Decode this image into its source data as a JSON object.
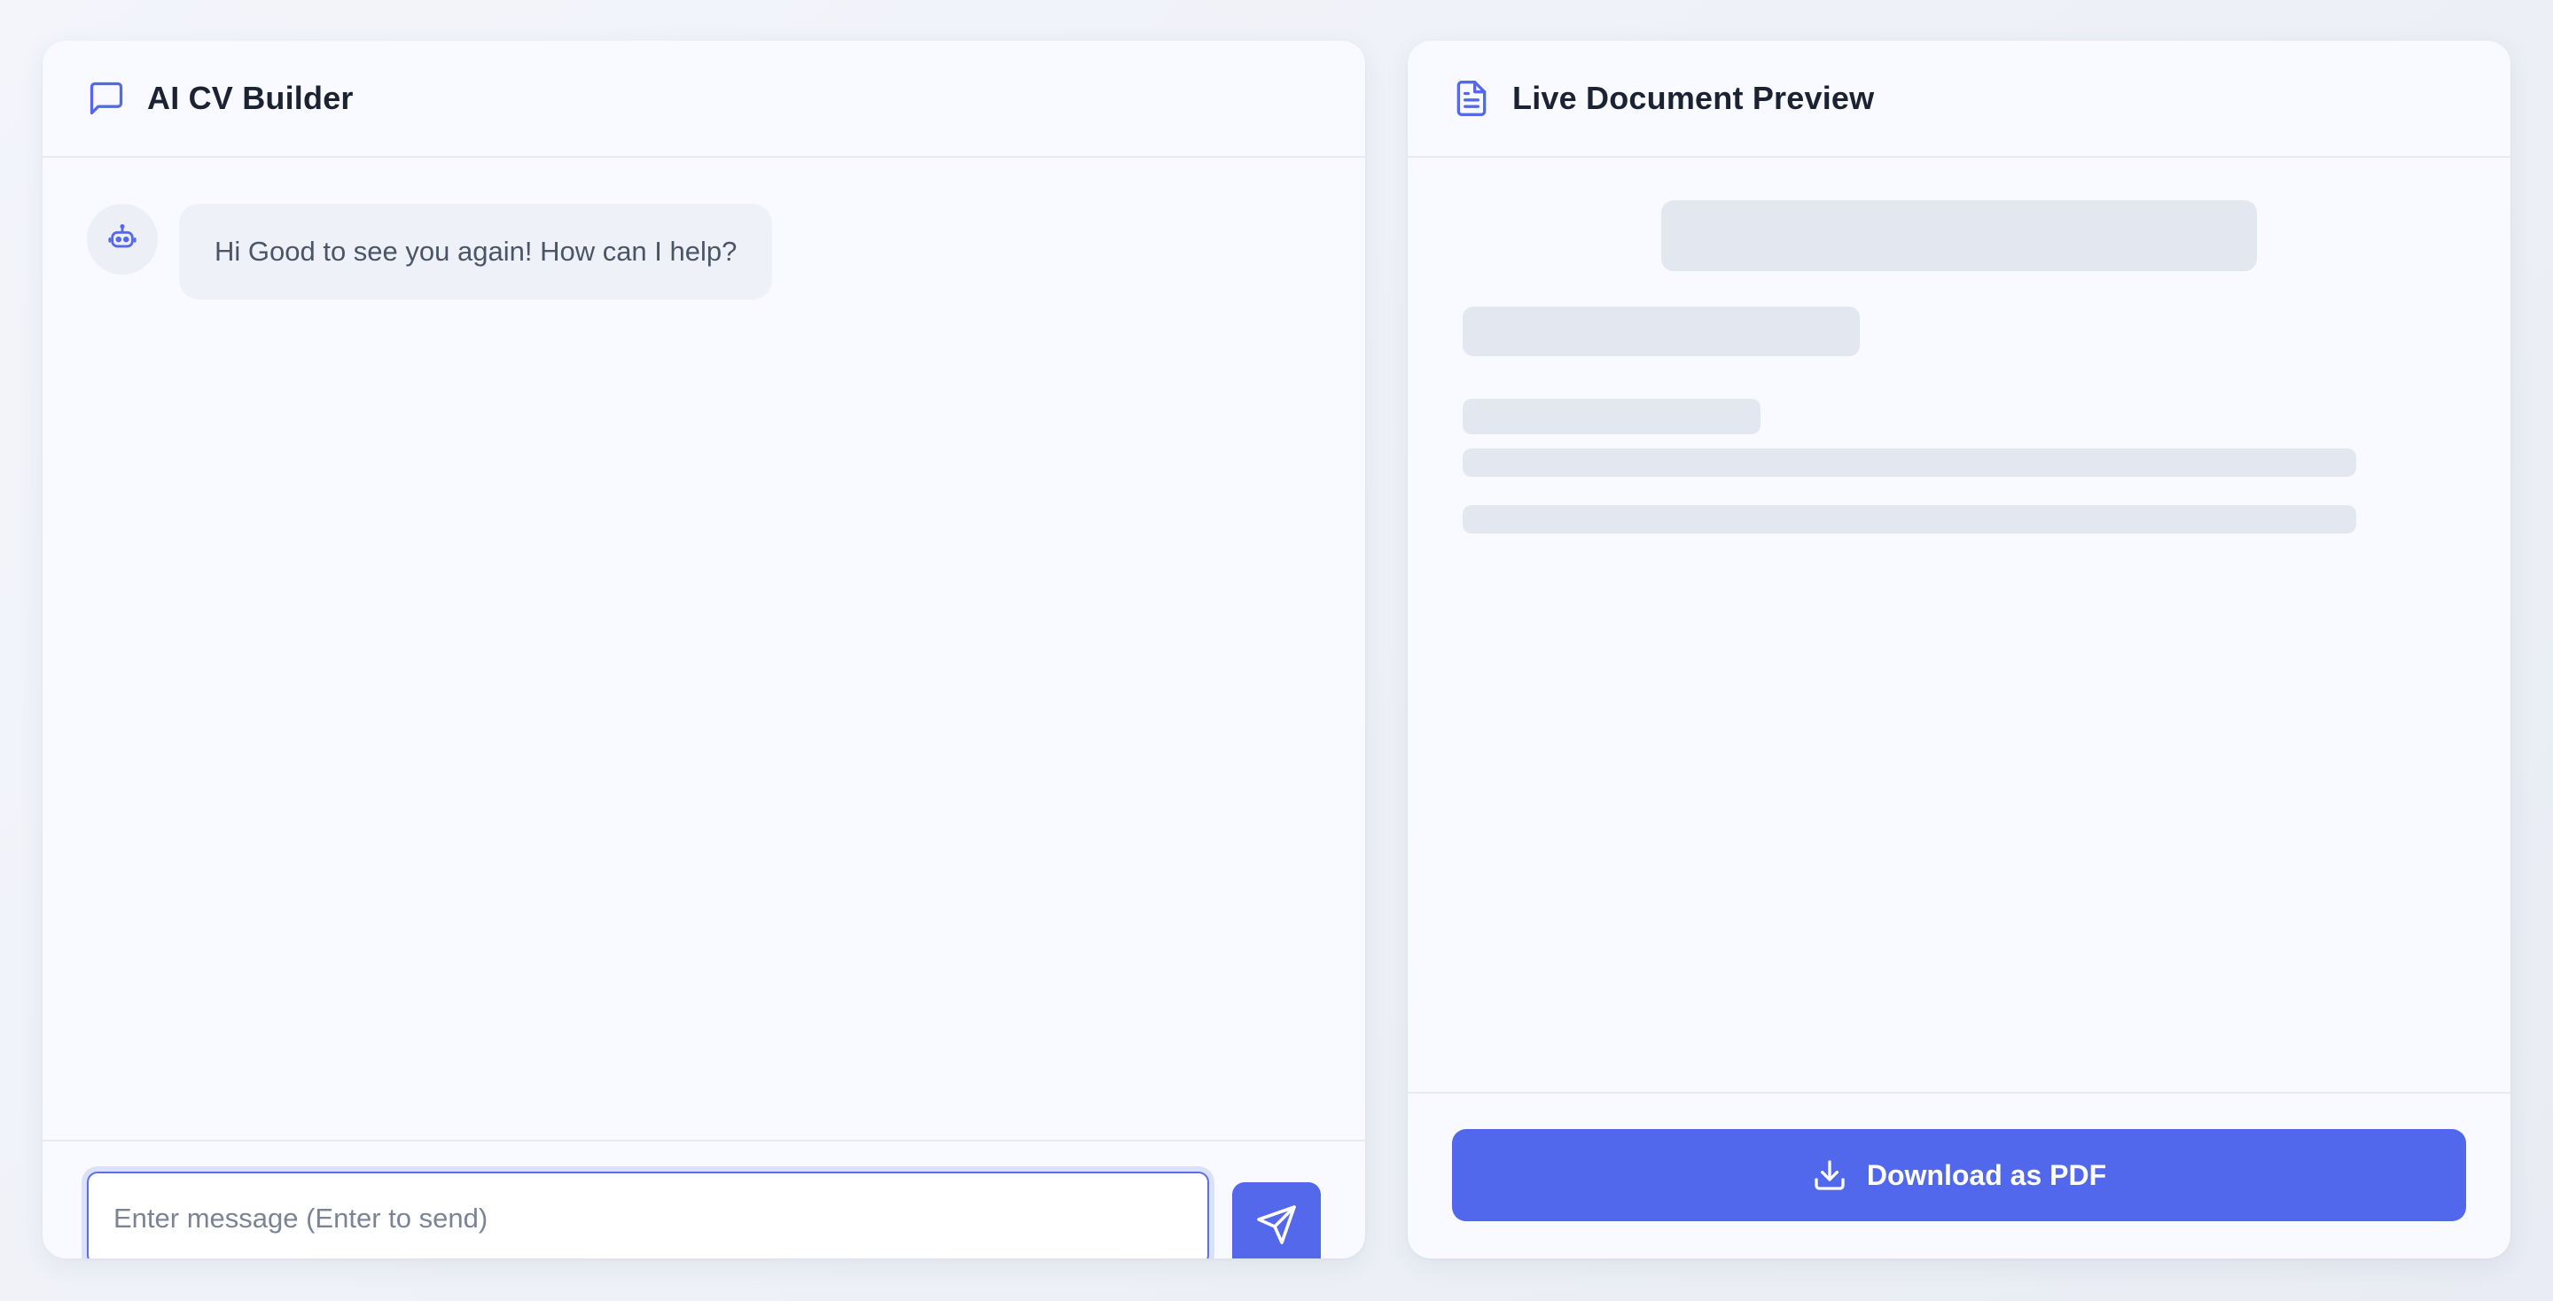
{
  "chat_panel": {
    "title": "AI CV Builder",
    "icon": "message-square-icon",
    "messages": [
      {
        "sender": "bot",
        "avatar_icon": "robot-icon",
        "text": "Hi Good to see you again! How can I help?"
      }
    ],
    "input": {
      "value": "",
      "placeholder": "Enter message (Enter to send)"
    },
    "send_button_icon": "send-icon"
  },
  "preview_panel": {
    "title": "Live Document Preview",
    "icon": "file-text-icon",
    "download_button": {
      "label": "Download as PDF",
      "icon": "download-icon"
    }
  },
  "colors": {
    "accent": "#5268ec",
    "panel_bg": "#f8faff",
    "skeleton": "#e3e7f0",
    "title_text": "#1b2333",
    "body_text": "#4a5568"
  }
}
